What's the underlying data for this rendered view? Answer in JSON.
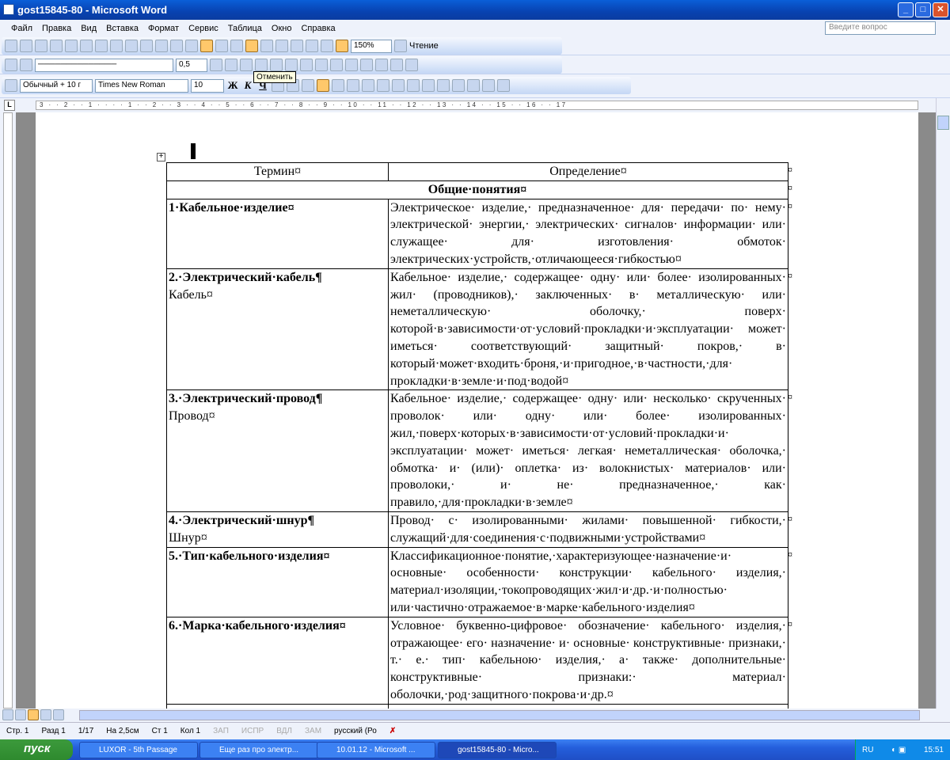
{
  "window": {
    "title": "gost15845-80 - Microsoft Word",
    "min": "_",
    "max": "□",
    "close": "✕"
  },
  "menu": [
    "Файл",
    "Правка",
    "Вид",
    "Вставка",
    "Формат",
    "Сервис",
    "Таблица",
    "Окно",
    "Справка"
  ],
  "help_placeholder": "Введите вопрос",
  "toolbar": {
    "zoom": "150%",
    "reading": "Чтение",
    "line_weight": "0,5",
    "style": "Обычный + 10 г",
    "font": "Times New Roman",
    "size": "10",
    "bold": "Ж",
    "italic": "К",
    "underline": "Ч",
    "tooltip": "Отменить"
  },
  "ruler": "3 · · 2 · · 1 · · · · 1 · · 2 · · 3 · · 4 · · 5 · · 6 · · 7 · · 8 · · 9 · · 10 · · 11 · · 12 · · 13 · · 14 · · 15 · · 16 · · 17",
  "table": {
    "headers": [
      "Термин¤",
      "Определение¤"
    ],
    "section": "Общие·понятия¤",
    "rows": [
      {
        "term": "1·Кабельное·изделие¤",
        "alt": "",
        "def": "Электрическое· изделие,· предназначенное· для· передачи· по· нему· электрической· энергии,· электрических· сигналов· информации· или· служащее· для· изготовления· обмоток· электрических·устройств,·отличающееся·гибкостью¤"
      },
      {
        "term": "2.·Электрический·кабель¶",
        "alt": "Кабель¤",
        "def": "Кабельное· изделие,· содержащее· одну· или· более· изолированных· жил· (проводников),· заключенных· в· металлическую· или· неметаллическую· оболочку,· поверх· которой·в·зависимости·от·условий·прокладки·и·эксплуатации· может· иметься· соответствующий· защитный· покров,· в· который·может·входить·броня,·и·пригодное,·в·частности,·для· прокладки·в·земле·и·под·водой¤"
      },
      {
        "term": "3.·Электрический·провод¶",
        "alt": "Провод¤",
        "def": "Кабельное· изделие,· содержащее· одну· или· несколько· скрученных· проволок· или· одну· или· более· изолированных· жил,·поверх·которых·в·зависимости·от·условий·прокладки·и· эксплуатации· может· иметься· легкая· неметаллическая· оболочка,· обмотка· и· (или)· оплетка· из· волокнистых· материалов· или· проволоки,· и· не· предназначенное,· как· правило,·для·прокладки·в·земле¤"
      },
      {
        "term": "4.·Электрический·шнур¶",
        "alt": "Шнур¤",
        "def": "Провод· с· изолированными· жилами· повышенной· гибкости,· служащий·для·соединения·с·подвижными·устройствами¤"
      },
      {
        "term": "5.·Тип·кабельного·изделия¤",
        "alt": "",
        "def": "Классификационное·понятие,·характеризующее·назначение·и· основные· особенности· конструкции· кабельного· изделия,· материал·изоляции,·токопроводящих·жил·и·др.·и·полностью· или·частично·отражаемое·в·марке·кабельного·изделия¤"
      },
      {
        "term": "6.·Марка·кабельного·изделия¤",
        "alt": "",
        "def": "Условное· буквенно-цифровое· обозначение· кабельного· изделия,· отражающее· его· назначение· и· основные· конструктивные· признаки,· т.· е.· тип· кабельною· изделия,· а· также· дополнительные· конструктивные· признаки:· материал· оболочки,·род·защитного·покрова·и·др.¤"
      }
    ],
    "row_end": "¤"
  },
  "status": {
    "page": "Стр. 1",
    "section": "Разд 1",
    "pages": "1/17",
    "at": "На 2,5см",
    "line": "Ст 1",
    "col": "Кол 1",
    "rec": "ЗАП",
    "trk": "ИСПР",
    "ext": "ВДЛ",
    "ovr": "ЗАМ",
    "lang": "русский (Ро"
  },
  "taskbar": {
    "start": "пуск",
    "tasks": [
      "LUXOR - 5th Passage",
      "Еще раз про электр...",
      "10.01.12 - Microsoft ...",
      "gost15845-80 - Micro..."
    ],
    "lang": "RU",
    "clock": "15:51"
  }
}
